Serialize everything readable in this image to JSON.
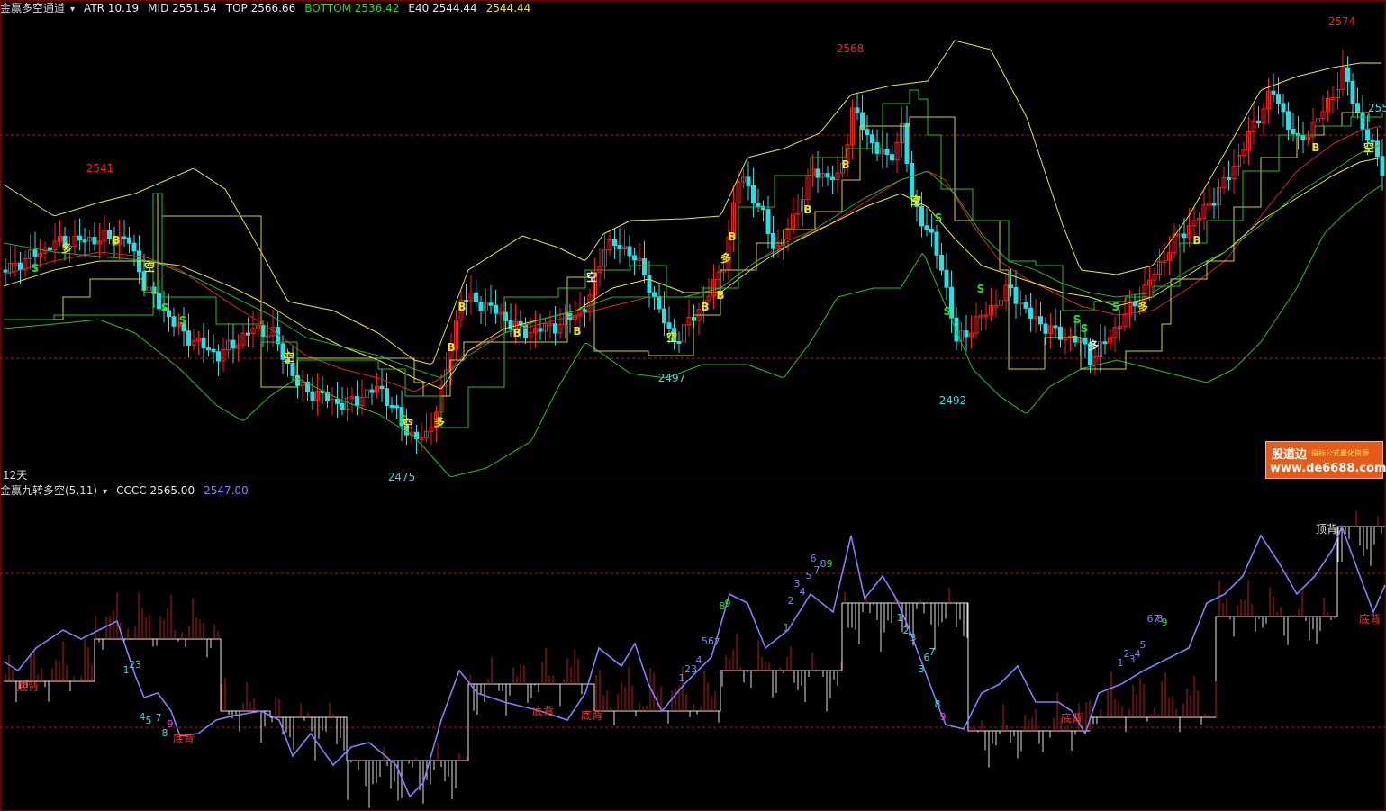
{
  "top_header": {
    "name": "金赢多空通道",
    "items": [
      {
        "text": "ATR 10.19",
        "color": "#e8e8e8"
      },
      {
        "text": "MID 2551.54",
        "color": "#e8e8e8"
      },
      {
        "text": "TOP 2566.66",
        "color": "#e8e8e8"
      },
      {
        "text": "BOTTOM 2536.42",
        "color": "#22e022"
      },
      {
        "text": "E40 2544.44",
        "color": "#e8e8e8"
      },
      {
        "text": "2544.44",
        "color": "#f2e800"
      }
    ]
  },
  "bottom_header": {
    "name": "金赢九转多空(5,11)",
    "items": [
      {
        "text": "CCCC 2565.00",
        "color": "#e8e8e8"
      },
      {
        "text": "2547.00",
        "color": "#8080ff"
      }
    ]
  },
  "period_label": "12天",
  "right_axis_label": "255",
  "price_labels": [
    "2541",
    "2475",
    "2497",
    "2568",
    "2492",
    "2574"
  ],
  "signal_labels": {
    "buy": "B",
    "sell": "S",
    "long": "多",
    "short": "空",
    "top_divergence": "顶背",
    "bottom_divergence": "底背"
  },
  "watermark": {
    "line1": "股道边",
    "line2": "指标公式量化资源",
    "line3": "www.de6688.com"
  },
  "colors": {
    "up": "#ff1a1a",
    "down": "#22e0e8",
    "upper_band": "#e8e830",
    "lower_band": "#20c020",
    "red_line": "#e02020",
    "green_line": "#22b022",
    "yellow_step": "#e8e830",
    "green_step": "#20c020",
    "osc_line": "#8080ff",
    "grid": "#a02020"
  }
}
